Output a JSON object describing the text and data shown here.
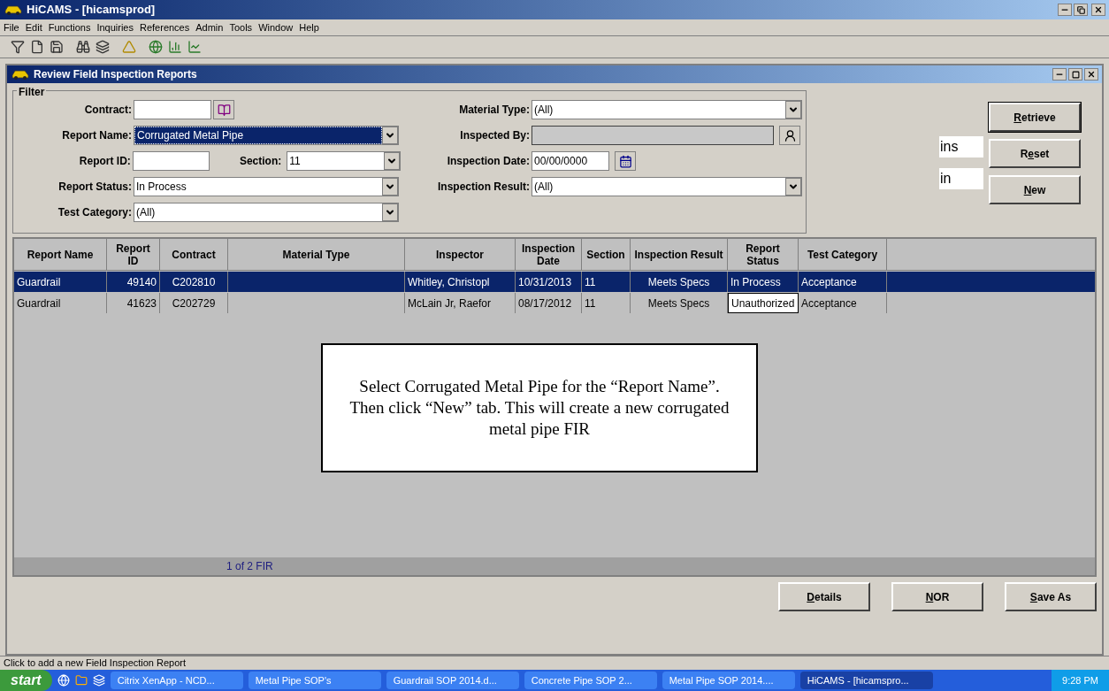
{
  "app_window": {
    "title": "HiCAMS - [hicamsprod]"
  },
  "menu": [
    "File",
    "Edit",
    "Functions",
    "Inquiries",
    "References",
    "Admin",
    "Tools",
    "Window",
    "Help"
  ],
  "child_window": {
    "title": "Review Field Inspection Reports"
  },
  "filter": {
    "title": "Filter",
    "left": [
      {
        "label": "Contract:",
        "kind": "lookup"
      },
      {
        "label": "Report Name:",
        "kind": "dropdown",
        "value": "Corrugated Metal Pipe",
        "focused": true
      },
      {
        "label": "Report ID:",
        "kind": "idsection",
        "section_label": "Section:",
        "section_value": "11"
      },
      {
        "label": "Report Status:",
        "kind": "dropdown",
        "value": "In Process",
        "focused": false
      },
      {
        "label": "Test Category:",
        "kind": "dropdown",
        "value": "(All)",
        "focused": false
      }
    ],
    "right": [
      {
        "label": "Material Type:",
        "kind": "dropdown",
        "value": "(All)"
      },
      {
        "label": "Inspected By:",
        "kind": "person",
        "disabled": true
      },
      {
        "label": "Inspection Date:",
        "kind": "date",
        "value": "00/00/0000"
      },
      {
        "label": "Inspection Result:",
        "kind": "dropdown",
        "value": "(All)"
      }
    ]
  },
  "side_boxes": [
    "ins",
    "in"
  ],
  "side_buttons": [
    {
      "label": "Retrieve"
    },
    {
      "label": "Reset"
    },
    {
      "label": "New"
    }
  ],
  "table": {
    "columns": [
      "Report Name",
      "Report ID",
      "Contract",
      "Material Type",
      "Inspector",
      "Inspection Date",
      "Section",
      "Inspection Result",
      "Report Status",
      "Test Category"
    ],
    "rows": [
      {
        "selected": true,
        "cells": [
          "Guardrail",
          "49140",
          "C202810",
          "",
          "Whitley, Christopl",
          "10/31/2013",
          "11",
          "Meets Specs",
          "In Process",
          "Acceptance"
        ]
      },
      {
        "selected": false,
        "cells": [
          "Guardrail",
          "41623",
          "C202729",
          "",
          "McLain Jr, Raefor",
          "08/17/2012",
          "11",
          "Meets Specs",
          "Unauthorized",
          "Acceptance"
        ]
      }
    ],
    "footer": "1 of 2 FIR"
  },
  "callout": "Select Corrugated Metal Pipe for the “Report Name”.  Then click “New” tab. This will create a new corrugated metal pipe FIR",
  "bottom_buttons": [
    {
      "label": "Details"
    },
    {
      "label": "NOR"
    },
    {
      "label": "Save As"
    }
  ],
  "status_bar": "Click to add a new Field Inspection Report",
  "taskbar": {
    "start": "start",
    "items": [
      {
        "label": "Citrix XenApp - NCD...",
        "selected": false
      },
      {
        "label": "Metal Pipe SOP's",
        "selected": false
      },
      {
        "label": "Guardrail SOP 2014.d...",
        "selected": false
      },
      {
        "label": "Concrete Pipe SOP 2...",
        "selected": false
      },
      {
        "label": "Metal Pipe SOP 2014....",
        "selected": false
      },
      {
        "label": "HiCAMS - [hicamspro...",
        "selected": true
      }
    ],
    "clock": "9:28 PM"
  }
}
